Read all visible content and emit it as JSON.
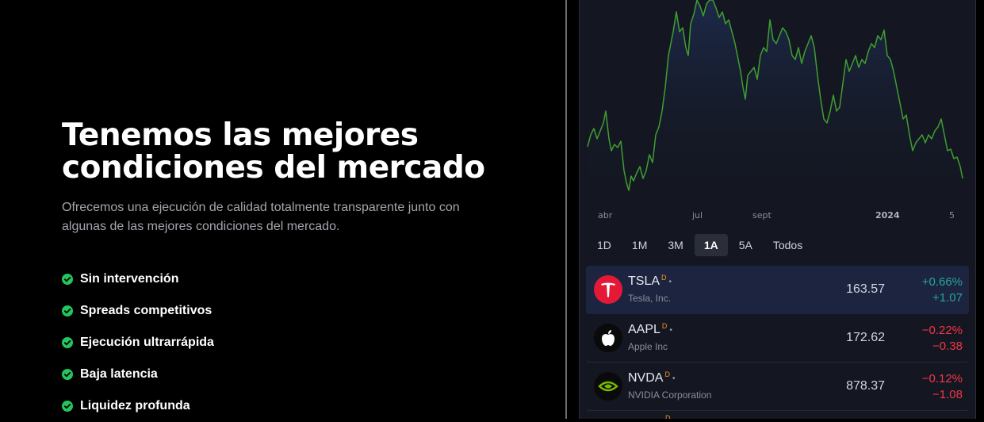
{
  "hero": {
    "title_line1": "Tenemos las mejores",
    "title_line2": "condiciones del mercado",
    "subtitle": "Ofrecemos una ejecución de calidad totalmente transparente junto con algunas de las mejores condiciones del mercado."
  },
  "features": [
    {
      "label": "Sin intervención",
      "icon": "check-circle-icon"
    },
    {
      "label": "Spreads competitivos",
      "icon": "check-circle-icon"
    },
    {
      "label": "Ejecución ultrarrápida",
      "icon": "check-circle-icon"
    },
    {
      "label": "Baja latencia",
      "icon": "check-circle-icon"
    },
    {
      "label": "Liquidez profunda",
      "icon": "check-circle-icon"
    }
  ],
  "colors": {
    "accent_green": "#22c55e",
    "chart_line": "#3f9e2f",
    "positive": "#26a69a",
    "negative": "#f23645",
    "selected_row": "#1c2440"
  },
  "chart": {
    "x_labels": [
      "abr",
      "jul",
      "sept",
      "2024",
      "5"
    ]
  },
  "range_tabs": [
    "1D",
    "1M",
    "3M",
    "1A",
    "5A",
    "Todos"
  ],
  "selected_range": "1A",
  "quotes": [
    {
      "symbol": "TSLA",
      "badge": "D",
      "company": "Tesla, Inc.",
      "price": "163.57",
      "change_pct": "+0.66%",
      "change_abs": "+1.07",
      "direction": "up",
      "logo": "tesla-logo"
    },
    {
      "symbol": "AAPL",
      "badge": "D",
      "company": "Apple Inc",
      "price": "172.62",
      "change_pct": "−0.22%",
      "change_abs": "−0.38",
      "direction": "down",
      "logo": "apple-logo"
    },
    {
      "symbol": "NVDA",
      "badge": "D",
      "company": "NVIDIA Corporation",
      "price": "878.37",
      "change_pct": "−0.12%",
      "change_abs": "−1.08",
      "direction": "down",
      "logo": "nvidia-logo"
    }
  ],
  "partial_row_badge": "D"
}
